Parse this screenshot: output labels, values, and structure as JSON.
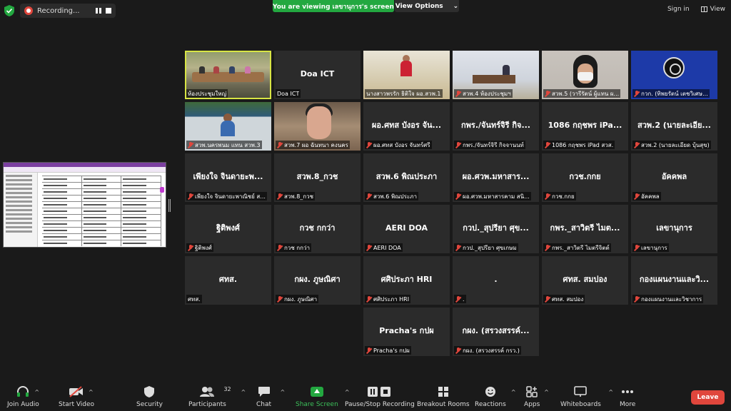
{
  "top": {
    "recording_label": "Recording...",
    "viewing_banner": "You are viewing เลขานุการ's screen",
    "view_options": "View Options",
    "sign_in": "Sign in",
    "view": "View"
  },
  "tiles": [
    {
      "name": "",
      "label": "ห้องประชุมใหญ่",
      "video": "room",
      "muted": false,
      "active": true
    },
    {
      "name": "Doa ICT",
      "label": "Doa ICT",
      "video": "",
      "muted": false
    },
    {
      "name": "",
      "label": "นางสาวพรรัก ธิติใจ ผอ.สวพ.1",
      "video": "office",
      "muted": false
    },
    {
      "name": "",
      "label": "สวพ.4 ห้องประชุมฯ",
      "video": "meet4",
      "muted": true
    },
    {
      "name": "",
      "label": "สวพ.5 (วารีรัตน์ ผู้แทน ผ...",
      "video": "mask",
      "muted": true
    },
    {
      "name": "",
      "label": "กวก. (ทิพยรัตน์ เตชวิเศษ...",
      "video": "obs",
      "muted": true
    },
    {
      "name": "",
      "label": "สวพ.นครพนม แทน สวพ.3",
      "video": "green",
      "muted": true
    },
    {
      "name": "",
      "label": "สวพ.7 ผอ ฉันทนา คงนคร",
      "video": "glass",
      "muted": true
    },
    {
      "name": "ผอ.ศทส บังอร จัน...",
      "label": "ผอ.ศทส บังอร จันทร์ศรี",
      "video": "",
      "muted": true
    },
    {
      "name": "กพร./จันทร์จิรี กิจ...",
      "label": "กพร./จันทร์จิรี กิจจานนท์",
      "video": "",
      "muted": true
    },
    {
      "name": "1086 กฤชพร iPa...",
      "label": "1086 กฤชพร iPad สวส.",
      "video": "",
      "muted": true
    },
    {
      "name": "สวพ.2 (นายละเอีย...",
      "label": "สวพ.2 (นายละเอียด บุ้นสุข)",
      "video": "",
      "muted": true
    },
    {
      "name": "เพียงใจ จินดายะพ...",
      "label": "เพียงใจ จินดายะพาณิชย์ ส...",
      "video": "",
      "muted": true
    },
    {
      "name": "สวพ.8_กวช",
      "label": "สวพ.8_กวช",
      "video": "",
      "muted": true
    },
    {
      "name": "สวพ.6 พิณประภา",
      "label": "สวพ.6 พิณประภา",
      "video": "",
      "muted": true
    },
    {
      "name": "ผอ.ศวพ.มหาสาร...",
      "label": "ผอ.ศวพ.มหาสารคาม สนิ...",
      "video": "",
      "muted": true
    },
    {
      "name": "กวช.กกย",
      "label": "กวช.กกย",
      "video": "",
      "muted": true
    },
    {
      "name": "อัคคพล",
      "label": "อัคคพล",
      "video": "",
      "muted": true
    },
    {
      "name": "ฐิติพงศ์",
      "label": "ฐิติพงศ์",
      "video": "",
      "muted": true
    },
    {
      "name": "กวช กกว่า",
      "label": "กวช กกว่า",
      "video": "",
      "muted": true
    },
    {
      "name": "AERI DOA",
      "label": "AERI DOA",
      "video": "",
      "muted": true
    },
    {
      "name": "กวป._สุปรียา ศุข...",
      "label": "กวป._สุปรียา ศุขเกษม",
      "video": "",
      "muted": true
    },
    {
      "name": "กพร._สาวิตรี ไมต...",
      "label": "กพร._สาวิตรี ไมตรีจิตต์",
      "video": "",
      "muted": true
    },
    {
      "name": "เลขานุการ",
      "label": "เลขานุการ",
      "video": "",
      "muted": true
    },
    {
      "name": "ศทส.",
      "label": "ศทส.",
      "video": "",
      "muted": false
    },
    {
      "name": "กผง. ภูษณิศา",
      "label": "กผง. ภูษณิศา",
      "video": "",
      "muted": true
    },
    {
      "name": "ศศิประภา HRI",
      "label": "ศศิประภา HRI",
      "video": "",
      "muted": true
    },
    {
      "name": ".",
      "label": ".",
      "video": "",
      "muted": true
    },
    {
      "name": "ศทส. สมปอง",
      "label": "ศทส. สมปอง",
      "video": "",
      "muted": true
    },
    {
      "name": "กองแผนงานและวิ...",
      "label": "กองแผนงานและวิชาการ",
      "video": "",
      "muted": true
    },
    {
      "name": "Pracha's กปผ",
      "label": "Pracha's กปผ",
      "video": "",
      "muted": true
    },
    {
      "name": "กผง. (สรวงสรรค์...",
      "label": "กผง. (สรวงสรรค์ กรว.)",
      "video": "",
      "muted": true
    }
  ],
  "toolbar": {
    "join_audio": "Join Audio",
    "start_video": "Start Video",
    "security": "Security",
    "participants": "Participants",
    "participants_count": "32",
    "chat": "Chat",
    "share_screen": "Share Screen",
    "pause_stop_recording": "Pause/Stop Recording",
    "breakout_rooms": "Breakout Rooms",
    "reactions": "Reactions",
    "apps": "Apps",
    "whiteboards": "Whiteboards",
    "more": "More",
    "leave": "Leave"
  },
  "colors": {
    "banner_green": "#23a840",
    "leave_red": "#e0463c",
    "active_speaker": "#d8e544",
    "tile_bg": "#2b2b2b"
  }
}
